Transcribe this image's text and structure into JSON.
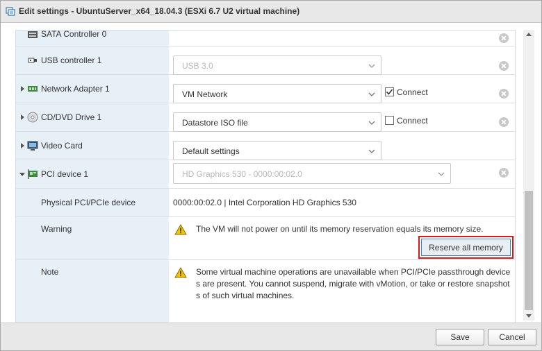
{
  "window": {
    "title": "Edit settings - UbuntuServer_x64_18.04.3 (ESXi 6.7 U2 virtual machine)"
  },
  "devices": [
    {
      "label": "SATA Controller 0",
      "icon": "sata-controller-icon"
    },
    {
      "label": "USB controller 1",
      "icon": "usb-icon",
      "select_value": "USB 3.0",
      "disabled": true
    },
    {
      "label": "Network Adapter 1",
      "icon": "network-adapter-icon",
      "select_value": "VM Network",
      "connect_label": "Connect",
      "connect_checked": true
    },
    {
      "label": "CD/DVD Drive 1",
      "icon": "cd-dvd-icon",
      "select_value": "Datastore ISO file",
      "connect_label": "Connect",
      "connect_checked": false
    },
    {
      "label": "Video Card",
      "icon": "video-card-icon",
      "select_value": "Default settings"
    },
    {
      "label": "PCI device 1",
      "icon": "pci-device-icon",
      "select_value": "HD Graphics 530 - 0000:00:02.0",
      "disabled": true,
      "expanded": true
    }
  ],
  "pci_details": {
    "physical_label": "Physical PCI/PCIe device",
    "physical_value": "0000:00:02.0 | Intel Corporation HD Graphics 530",
    "warning_label": "Warning",
    "warning_text": "The VM will not power on until its memory reservation equals its memory size.",
    "reserve_button": "Reserve all memory",
    "note_label": "Note",
    "note_text": "Some virtual machine operations are unavailable when PCI/PCIe passthrough devices are present. You cannot suspend, migrate with vMotion, or take or restore snapshots of such virtual machines."
  },
  "footer": {
    "save_label": "Save",
    "cancel_label": "Cancel"
  },
  "colors": {
    "highlight": "#d61a1a",
    "left_column": "#e8f0f7",
    "warning": "#f5c400"
  }
}
